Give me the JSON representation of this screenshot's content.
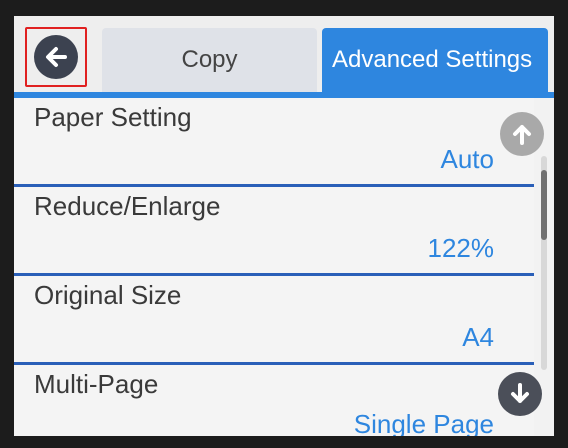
{
  "header": {
    "tabs": [
      {
        "label": "Copy",
        "active": false
      },
      {
        "label": "Advanced Settings",
        "active": true
      }
    ],
    "back_icon": "arrow-left-circle-icon"
  },
  "settings": [
    {
      "label": "Paper Setting",
      "value": "Auto"
    },
    {
      "label": "Reduce/Enlarge",
      "value": "122%"
    },
    {
      "label": "Original Size",
      "value": "A4"
    },
    {
      "label": "Multi-Page",
      "value": "Single Page"
    }
  ],
  "scroll": {
    "up_icon": "arrow-up-circle-icon",
    "down_icon": "arrow-down-circle-icon"
  },
  "colors": {
    "accent": "#2e86df",
    "divider": "#2a5fb8",
    "highlight_box": "#e02020"
  }
}
